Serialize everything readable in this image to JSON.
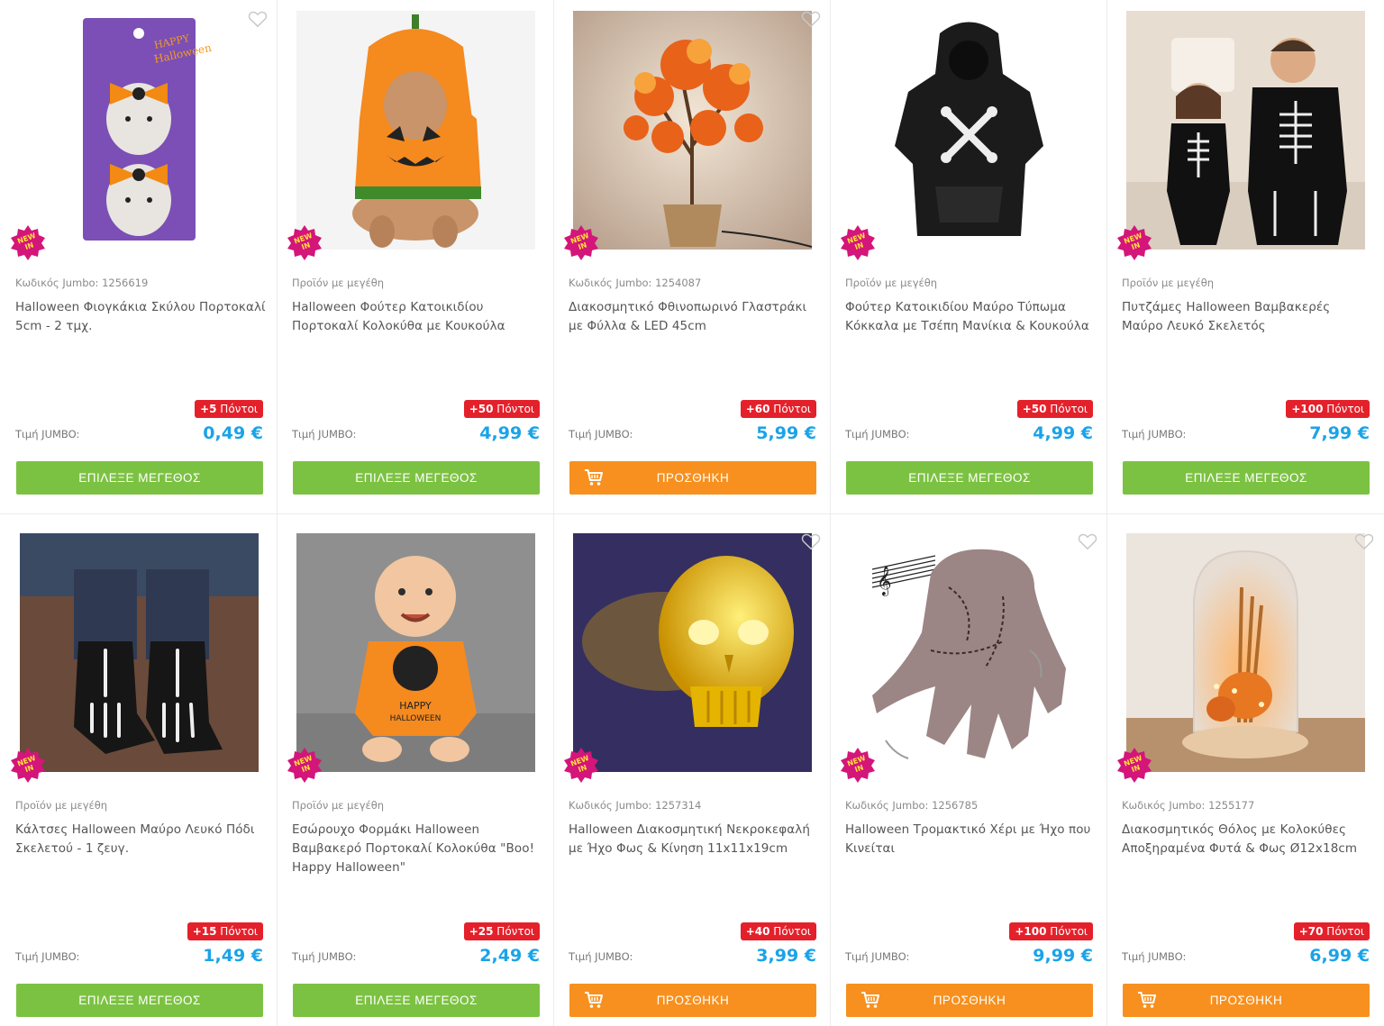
{
  "price_label": "Τιμή JUMBO:",
  "new_badge": "NEW IN",
  "colors": {
    "price": "#1aa3e8",
    "points": "#e4212b",
    "green_button": "#7cc242",
    "orange_button": "#f7901e",
    "new_badge": "#d4157a"
  },
  "products": [
    {
      "code": "Κωδικός Jumbo: 1256619",
      "title": "Halloween Φιογκάκια Σκύλου Πορτοκαλί 5cm - 2 τμχ.",
      "points": "+5 Πόντοι",
      "price": "0,49 €",
      "button": "ΕΠΙΛΕΞΕ ΜΕΓΕΘΟΣ",
      "button_type": "size",
      "image": "dog-bows-packaging",
      "wishlist": true
    },
    {
      "code": "Προϊόν με μεγέθη",
      "title": "Halloween Φούτερ Κατοικιδίου Πορτοκαλί Κολοκύθα με Κουκούλα",
      "points": "+50 Πόντοι",
      "price": "4,99 €",
      "button": "ΕΠΙΛΕΞΕ ΜΕΓΕΘΟΣ",
      "button_type": "size",
      "image": "dog-pumpkin-hoodie",
      "wishlist": false
    },
    {
      "code": "Κωδικός Jumbo: 1254087",
      "title": "Διακοσμητικό Φθινοπωρινό Γλαστράκι με Φύλλα & LED 45cm",
      "points": "+60 Πόντοι",
      "price": "5,99 €",
      "button": "ΠΡΟΣΘΗΚΗ",
      "button_type": "cart",
      "image": "autumn-led-tree",
      "wishlist": true
    },
    {
      "code": "Προϊόν με μεγέθη",
      "title": "Φούτερ Κατοικιδίου Μαύρο Τύπωμα Κόκκαλα με Τσέπη Μανίκια & Κουκούλα",
      "points": "+50 Πόντοι",
      "price": "4,99 €",
      "button": "ΕΠΙΛΕΞΕ ΜΕΓΕΘΟΣ",
      "button_type": "size",
      "image": "black-bone-hoodie",
      "wishlist": false
    },
    {
      "code": "Προϊόν με μεγέθη",
      "title": "Πυτζάμες Halloween Βαμβακερές Μαύρο Λευκό Σκελετός",
      "points": "+100 Πόντοι",
      "price": "7,99 €",
      "button": "ΕΠΙΛΕΞΕ ΜΕΓΕΘΟΣ",
      "button_type": "size",
      "image": "skeleton-pajamas",
      "wishlist": false
    },
    {
      "code": "Προϊόν με μεγέθη",
      "title": "Κάλτσες Halloween Μαύρο Λευκό Πόδι Σκελετού - 1 ζευγ.",
      "points": "+15 Πόντοι",
      "price": "1,49 €",
      "button": "ΕΠΙΛΕΞΕ ΜΕΓΕΘΟΣ",
      "button_type": "size",
      "image": "skeleton-socks",
      "wishlist": false
    },
    {
      "code": "Προϊόν με μεγέθη",
      "title": "Εσώρουχο Φορμάκι Halloween Βαμβακερό Πορτοκαλί Κολοκύθα \"Boo! Happy Halloween\"",
      "points": "+25 Πόντοι",
      "price": "2,49 €",
      "button": "ΕΠΙΛΕΞΕ ΜΕΓΕΘΟΣ",
      "button_type": "size",
      "image": "baby-pumpkin-bodysuit",
      "wishlist": false
    },
    {
      "code": "Κωδικός Jumbo: 1257314",
      "title": "Halloween Διακοσμητική Νεκροκεφαλή με Ήχο Φως & Κίνηση 11x11x19cm",
      "points": "+40 Πόντοι",
      "price": "3,99 €",
      "button": "ΠΡΟΣΘΗΚΗ",
      "button_type": "cart",
      "image": "glowing-skull",
      "wishlist": true
    },
    {
      "code": "Κωδικός Jumbo: 1256785",
      "title": "Halloween Τρομακτικό Χέρι με Ήχο που Κινείται",
      "points": "+100 Πόντοι",
      "price": "9,99 €",
      "button": "ΠΡΟΣΘΗΚΗ",
      "button_type": "cart",
      "image": "moving-hand",
      "wishlist": true
    },
    {
      "code": "Κωδικός Jumbo: 1255177",
      "title": "Διακοσμητικός Θόλος με Κολοκύθες Αποξηραμένα Φυτά & Φως Ø12x18cm",
      "points": "+70 Πόντοι",
      "price": "6,99 €",
      "button": "ΠΡΟΣΘΗΚΗ",
      "button_type": "cart",
      "image": "glass-dome-pumpkins",
      "wishlist": true
    }
  ]
}
